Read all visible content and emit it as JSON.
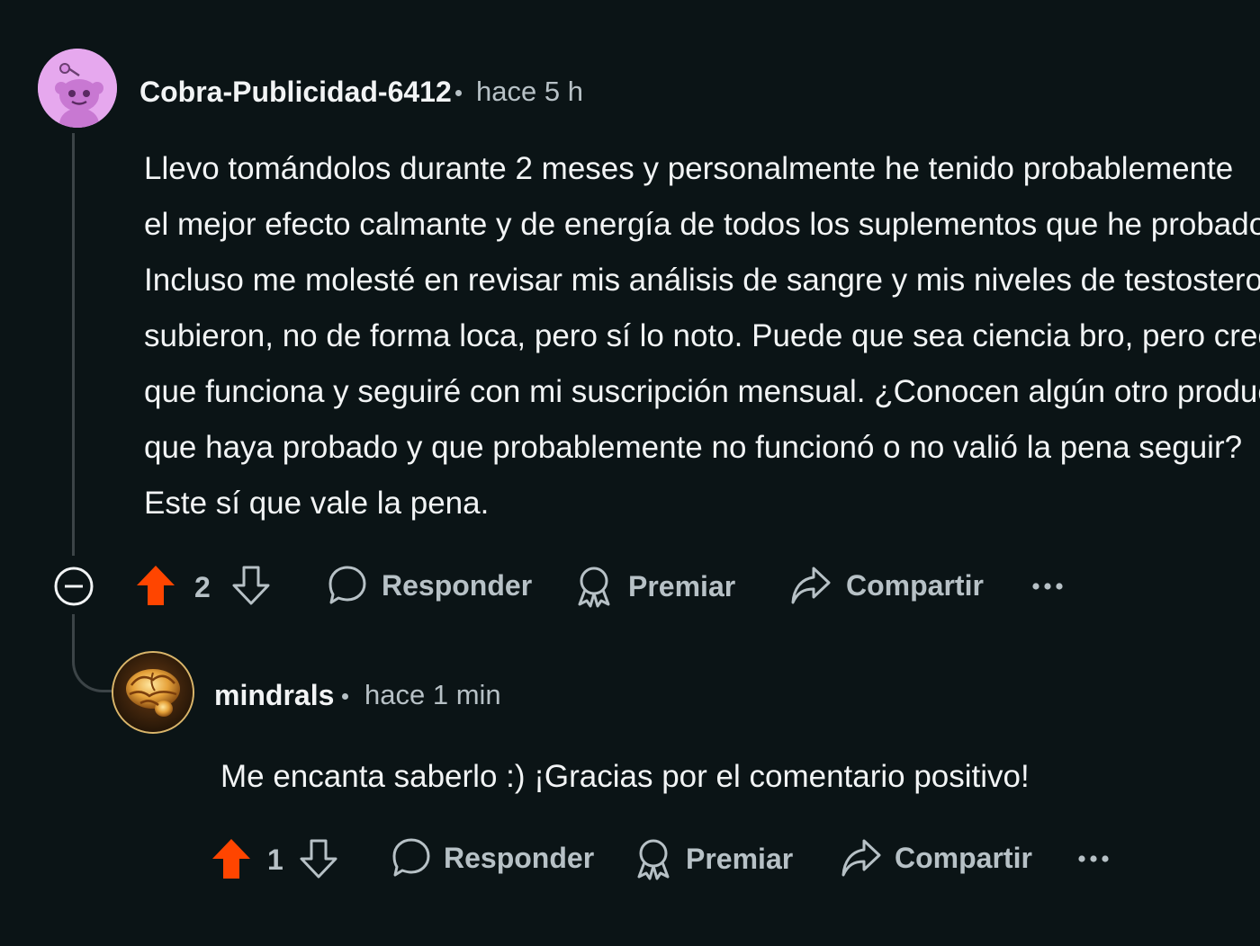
{
  "colors": {
    "background": "#0b1416",
    "upvote_active": "#ff4500",
    "text_primary": "#f2f4f5",
    "text_secondary": "#b7c1c6",
    "thread_line": "#3c4447",
    "avatar1_bg": "#e6a8ee"
  },
  "comment1": {
    "username": "Cobra-Publicidad-6412",
    "time": "hace 5 h",
    "avatar_icon": "snoo-avatar-icon",
    "body_lines": [
      "Llevo tomándolos durante 2 meses y personalmente he tenido probablemente",
      "el mejor efecto calmante y de energía de todos los suplementos que he probado.",
      "Incluso me molesté en revisar mis análisis de sangre y mis niveles de testosterona",
      "subieron, no de forma loca, pero sí lo noto. Puede que sea ciencia bro, pero creo",
      "que funciona y seguiré con mi suscripción mensual. ¿Conocen algún otro producto",
      "que haya probado y que probablemente no funcionó o no valió la pena seguir?",
      "Este sí que vale la pena."
    ],
    "votes": "2",
    "upvoted": true,
    "actions": {
      "reply": "Responder",
      "award": "Premiar",
      "share": "Compartir"
    }
  },
  "comment2": {
    "username": "mindrals",
    "time": "hace 1 min",
    "avatar_icon": "brain-avatar-icon",
    "body": "Me encanta saberlo :) ¡Gracias por el comentario positivo!",
    "votes": "1",
    "upvoted": true,
    "actions": {
      "reply": "Responder",
      "award": "Premiar",
      "share": "Compartir"
    }
  }
}
